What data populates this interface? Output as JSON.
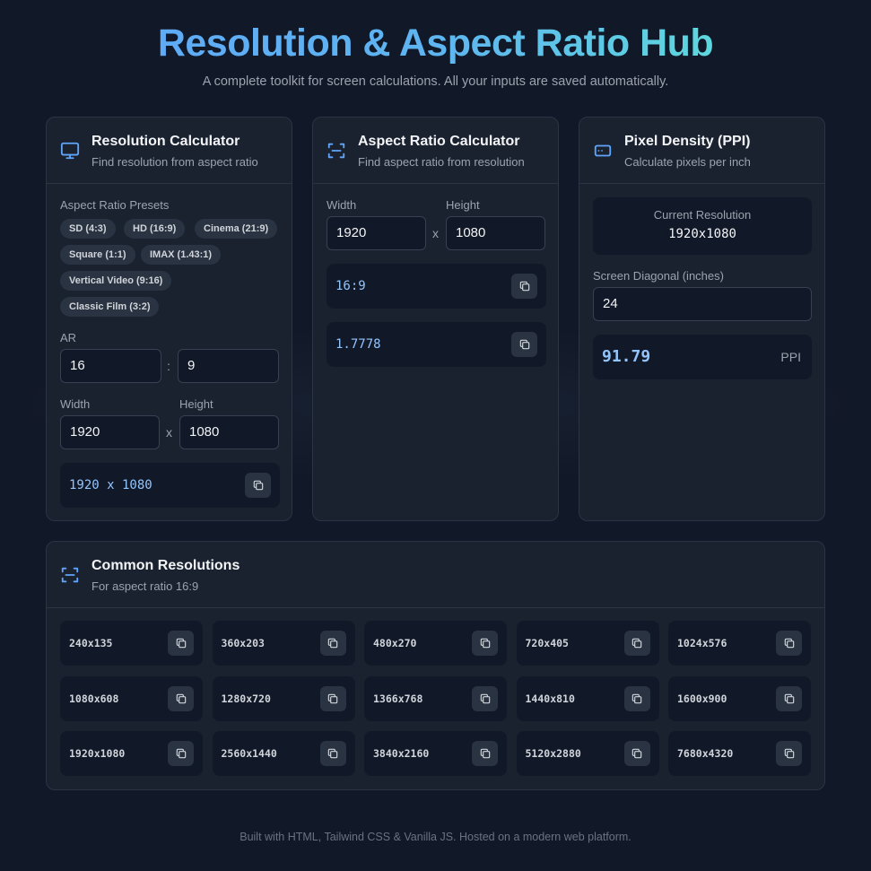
{
  "header": {
    "title": "Resolution & Aspect Ratio Hub",
    "subtitle": "A complete toolkit for screen calculations. All your inputs are saved automatically."
  },
  "resolution_calc": {
    "title": "Resolution Calculator",
    "subtitle": "Find resolution from aspect ratio",
    "presets_label": "Aspect Ratio Presets",
    "presets": [
      "SD (4:3)",
      "HD (16:9)",
      "Cinema (21:9)",
      "Square (1:1)",
      "IMAX (1.43:1)",
      "Vertical Video (9:16)",
      "Classic Film (3:2)"
    ],
    "ar_label": "AR",
    "ar_w": "16",
    "ar_sep": ":",
    "ar_h": "9",
    "width_label": "Width",
    "height_label": "Height",
    "width": "1920",
    "x_sep": "x",
    "height": "1080",
    "result": "1920 x 1080"
  },
  "aspect_calc": {
    "title": "Aspect Ratio Calculator",
    "subtitle": "Find aspect ratio from resolution",
    "width_label": "Width",
    "height_label": "Height",
    "width": "1920",
    "x_sep": "x",
    "height": "1080",
    "ratio": "16:9",
    "decimal": "1.7778"
  },
  "ppi_calc": {
    "title": "Pixel Density (PPI)",
    "subtitle": "Calculate pixels per inch",
    "current_label": "Current Resolution",
    "current_value": "1920x1080",
    "diagonal_label": "Screen Diagonal (inches)",
    "diagonal": "24",
    "ppi_value": "91.79",
    "ppi_unit": "PPI"
  },
  "common": {
    "title": "Common Resolutions",
    "subtitle": "For aspect ratio 16:9",
    "items": [
      "240x135",
      "360x203",
      "480x270",
      "720x405",
      "1024x576",
      "1080x608",
      "1280x720",
      "1366x768",
      "1440x810",
      "1600x900",
      "1920x1080",
      "2560x1440",
      "3840x2160",
      "5120x2880",
      "7680x4320"
    ]
  },
  "footer": "Built with HTML, Tailwind CSS & Vanilla JS. Hosted on a modern web platform.",
  "colors": {
    "background": "#111827",
    "card": "#1a2230",
    "accent": "#60a5fa",
    "accent_teal": "#5eead4",
    "mono_value": "#93c5fd"
  },
  "icons": {
    "resolution_calc": "monitor-icon",
    "aspect_calc": "scan-frame-icon",
    "ppi_calc": "screen-dots-icon",
    "common": "scan-frame-icon",
    "copy": "copy-icon"
  }
}
